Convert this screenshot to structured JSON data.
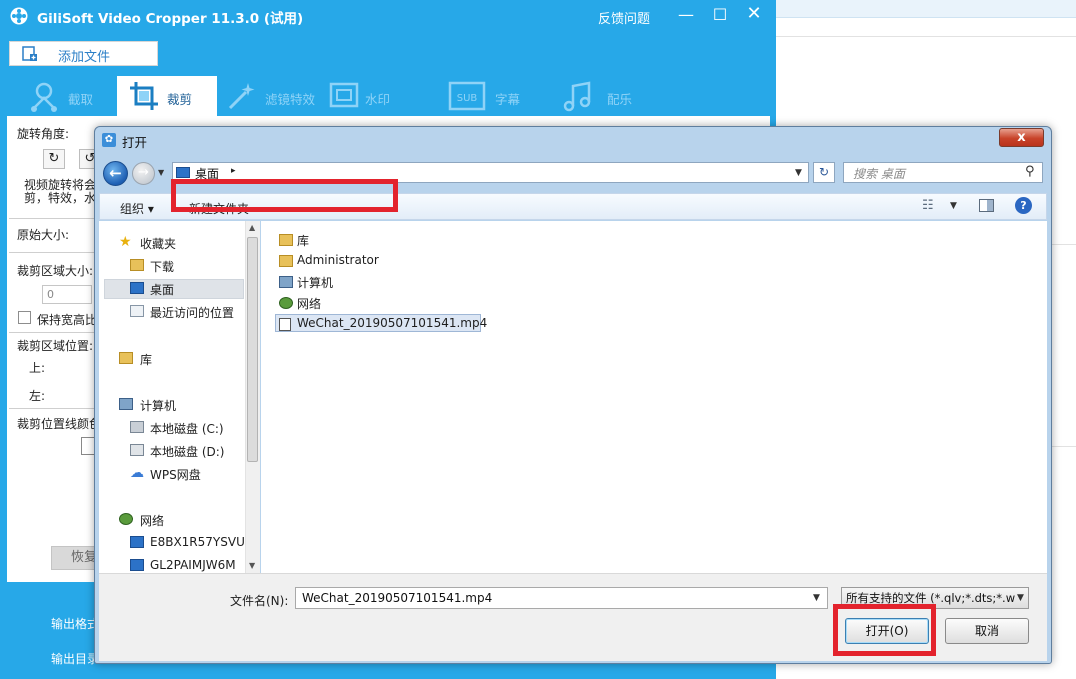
{
  "app": {
    "title": "GiliSoft Video Cropper 11.3.0 (试用)",
    "feedback": "反馈问题",
    "minimize": "—",
    "maximize": "☐",
    "close": "✕",
    "add_file": "添加文件",
    "tabs": [
      "截取",
      "裁剪",
      "滤镜特效",
      "水印",
      "字幕",
      "配乐"
    ],
    "left_panel": {
      "rotate_angle": "旋转角度:",
      "rotate_left": "↻",
      "rotate_right": "↺",
      "rotate_note_1": "视频旋转将会",
      "rotate_note_2": "剪，特效，水印",
      "original_size": "原始大小:",
      "crop_area_size": "裁剪区域大小:",
      "width_value": "0",
      "keep_ratio": "保持宽高比",
      "crop_area_pos": "裁剪区域位置:",
      "top": "上:",
      "left": "左:",
      "crop_line_color": "裁剪位置线颜色",
      "restore": "恢复"
    },
    "output_format": "输出格式",
    "output_dir": "输出目录"
  },
  "dialog": {
    "title": "打开",
    "close": "x",
    "back": "←",
    "forward": "→",
    "address": "桌面",
    "address_arrow": "▸",
    "dropdown": "▼",
    "refresh": "↻",
    "search_placeholder": "搜索 桌面",
    "search_icon": "⚲",
    "organize": "组织 ▾",
    "new_folder": "新建文件夹",
    "view": "☷",
    "view_arrow": "▼",
    "help": "?",
    "nav": {
      "favorites": "收藏夹",
      "downloads": "下载",
      "desktop": "桌面",
      "recent": "最近访问的位置",
      "libraries": "库",
      "computer": "计算机",
      "drive_c": "本地磁盘 (C:)",
      "drive_d": "本地磁盘 (D:)",
      "wps": "WPS网盘",
      "network": "网络",
      "pc1": "E8BX1R57YSVU",
      "pc2": "GL2PAIMJW6M"
    },
    "files": [
      "库",
      "Administrator",
      "计算机",
      "网络",
      "WeChat_20190507101541.mp4"
    ],
    "filename_label": "文件名(N):",
    "filename_value": "WeChat_20190507101541.mp4",
    "filter_value": "所有支持的文件 (*.qlv;*.dts;*.w",
    "open": "打开(O)",
    "cancel": "取消"
  },
  "colors": {
    "app_blue": "#27a8e8",
    "highlight_red": "#e3232d"
  }
}
